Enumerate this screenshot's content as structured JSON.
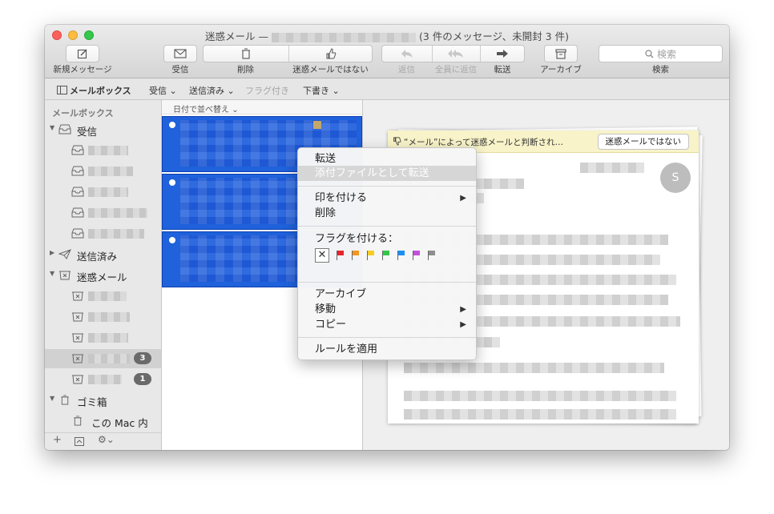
{
  "window": {
    "title_prefix": "迷惑メール —",
    "title_suffix": "(3 件のメッセージ、未開封 3 件)"
  },
  "toolbar": {
    "new_message": "新規メッセージ",
    "get_mail": "受信",
    "delete": "削除",
    "not_junk": "迷惑メールではない",
    "reply": "返信",
    "reply_all": "全員に返信",
    "forward": "転送",
    "archive": "アーカイブ",
    "search_placeholder": "検索",
    "search_label": "検索"
  },
  "favorites": {
    "mailboxes": "メールボックス",
    "inbox": "受信",
    "sent": "送信済み",
    "flagged": "フラグ付き",
    "drafts": "下書き"
  },
  "sidebar": {
    "header": "メールボックス",
    "inbox": "受信",
    "sent": "送信済み",
    "junk": "迷惑メール",
    "junk_badges": [
      "3",
      "1"
    ],
    "trash": "ゴミ箱",
    "on_my_mac": "この Mac 内"
  },
  "message_list": {
    "sort_label": "日付で並べ替え"
  },
  "preview": {
    "junk_notice": "“メール”によって迷惑メールと判断され…",
    "not_junk_button": "迷惑メールではない",
    "avatar_initial": "S"
  },
  "context_menu": {
    "forward": "転送",
    "forward_as_attachment": "添付ファイルとして転送",
    "mark": "印を付ける",
    "delete": "削除",
    "flag_header": "フラグを付ける：",
    "clear_flag": "✕",
    "flag_colors": [
      "#e8232c",
      "#f3951f",
      "#f6cc20",
      "#34c64a",
      "#1c8ff0",
      "#c44fdb",
      "#8e8e8e"
    ],
    "archive": "アーカイブ",
    "move": "移動",
    "copy": "コピー",
    "apply_rules": "ルールを適用"
  }
}
